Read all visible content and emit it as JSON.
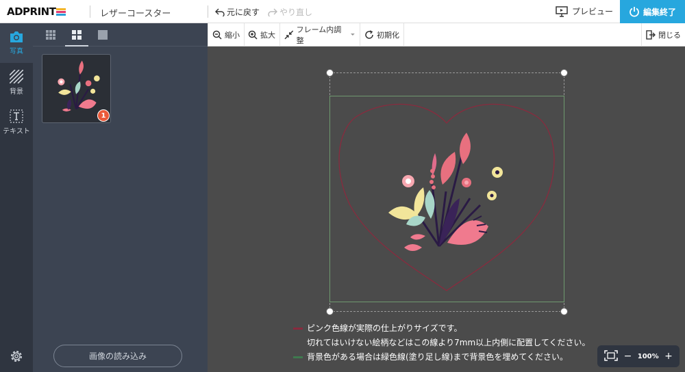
{
  "header": {
    "logo_text": "ADPRINT",
    "product_title": "レザーコースター",
    "undo_label": "元に戻す",
    "redo_label": "やり直し",
    "preview_label": "プレビュー",
    "finish_label": "編集終了"
  },
  "rail": {
    "items": [
      {
        "label": "写真",
        "icon": "camera-icon"
      },
      {
        "label": "背景",
        "icon": "hatch-icon"
      },
      {
        "label": "テキスト",
        "icon": "text-icon"
      }
    ],
    "settings_icon": "gear-icon"
  },
  "panel": {
    "thumb_badge": "1",
    "load_button": "画像の読み込み"
  },
  "toolbar": {
    "zoom_out": "縮小",
    "zoom_in": "拡大",
    "fit_frame": "フレーム内調整",
    "reset": "初期化",
    "close": "閉じる"
  },
  "notes": {
    "line1": "ピンク色線が実際の仕上がりサイズです。",
    "line2": "切れてはいけない絵柄などはこの線より7mm以上内側に配置してください。",
    "line3": "背景色がある場合は緑色線(塗り足し線)まで背景色を埋めてください。"
  },
  "zoom": {
    "value": "100%"
  },
  "colors": {
    "accent": "#27a7de",
    "badge": "#ea5a3a",
    "pink_line": "#8a2a3e",
    "green_line": "#3f7a4f"
  }
}
